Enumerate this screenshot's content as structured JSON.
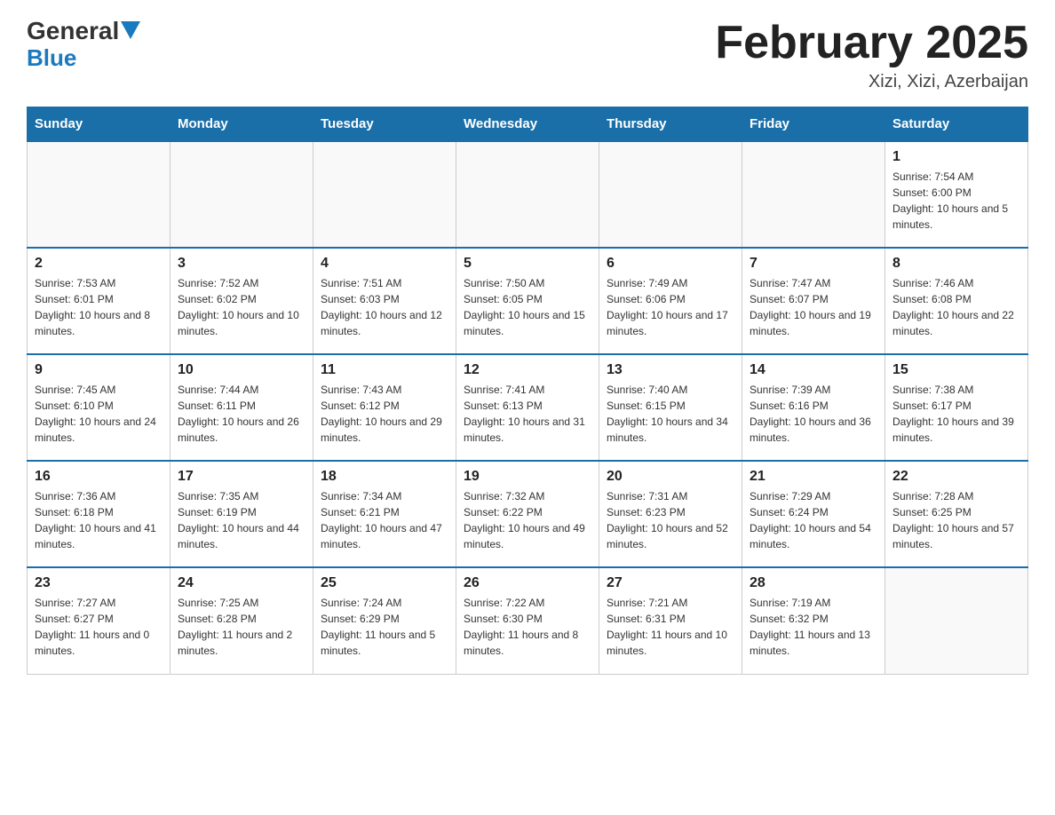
{
  "header": {
    "logo_text_general": "General",
    "logo_text_blue": "Blue",
    "month_title": "February 2025",
    "location": "Xizi, Xizi, Azerbaijan"
  },
  "weekdays": [
    "Sunday",
    "Monday",
    "Tuesday",
    "Wednesday",
    "Thursday",
    "Friday",
    "Saturday"
  ],
  "weeks": [
    [
      {
        "day": "",
        "sunrise": "",
        "sunset": "",
        "daylight": ""
      },
      {
        "day": "",
        "sunrise": "",
        "sunset": "",
        "daylight": ""
      },
      {
        "day": "",
        "sunrise": "",
        "sunset": "",
        "daylight": ""
      },
      {
        "day": "",
        "sunrise": "",
        "sunset": "",
        "daylight": ""
      },
      {
        "day": "",
        "sunrise": "",
        "sunset": "",
        "daylight": ""
      },
      {
        "day": "",
        "sunrise": "",
        "sunset": "",
        "daylight": ""
      },
      {
        "day": "1",
        "sunrise": "Sunrise: 7:54 AM",
        "sunset": "Sunset: 6:00 PM",
        "daylight": "Daylight: 10 hours and 5 minutes."
      }
    ],
    [
      {
        "day": "2",
        "sunrise": "Sunrise: 7:53 AM",
        "sunset": "Sunset: 6:01 PM",
        "daylight": "Daylight: 10 hours and 8 minutes."
      },
      {
        "day": "3",
        "sunrise": "Sunrise: 7:52 AM",
        "sunset": "Sunset: 6:02 PM",
        "daylight": "Daylight: 10 hours and 10 minutes."
      },
      {
        "day": "4",
        "sunrise": "Sunrise: 7:51 AM",
        "sunset": "Sunset: 6:03 PM",
        "daylight": "Daylight: 10 hours and 12 minutes."
      },
      {
        "day": "5",
        "sunrise": "Sunrise: 7:50 AM",
        "sunset": "Sunset: 6:05 PM",
        "daylight": "Daylight: 10 hours and 15 minutes."
      },
      {
        "day": "6",
        "sunrise": "Sunrise: 7:49 AM",
        "sunset": "Sunset: 6:06 PM",
        "daylight": "Daylight: 10 hours and 17 minutes."
      },
      {
        "day": "7",
        "sunrise": "Sunrise: 7:47 AM",
        "sunset": "Sunset: 6:07 PM",
        "daylight": "Daylight: 10 hours and 19 minutes."
      },
      {
        "day": "8",
        "sunrise": "Sunrise: 7:46 AM",
        "sunset": "Sunset: 6:08 PM",
        "daylight": "Daylight: 10 hours and 22 minutes."
      }
    ],
    [
      {
        "day": "9",
        "sunrise": "Sunrise: 7:45 AM",
        "sunset": "Sunset: 6:10 PM",
        "daylight": "Daylight: 10 hours and 24 minutes."
      },
      {
        "day": "10",
        "sunrise": "Sunrise: 7:44 AM",
        "sunset": "Sunset: 6:11 PM",
        "daylight": "Daylight: 10 hours and 26 minutes."
      },
      {
        "day": "11",
        "sunrise": "Sunrise: 7:43 AM",
        "sunset": "Sunset: 6:12 PM",
        "daylight": "Daylight: 10 hours and 29 minutes."
      },
      {
        "day": "12",
        "sunrise": "Sunrise: 7:41 AM",
        "sunset": "Sunset: 6:13 PM",
        "daylight": "Daylight: 10 hours and 31 minutes."
      },
      {
        "day": "13",
        "sunrise": "Sunrise: 7:40 AM",
        "sunset": "Sunset: 6:15 PM",
        "daylight": "Daylight: 10 hours and 34 minutes."
      },
      {
        "day": "14",
        "sunrise": "Sunrise: 7:39 AM",
        "sunset": "Sunset: 6:16 PM",
        "daylight": "Daylight: 10 hours and 36 minutes."
      },
      {
        "day": "15",
        "sunrise": "Sunrise: 7:38 AM",
        "sunset": "Sunset: 6:17 PM",
        "daylight": "Daylight: 10 hours and 39 minutes."
      }
    ],
    [
      {
        "day": "16",
        "sunrise": "Sunrise: 7:36 AM",
        "sunset": "Sunset: 6:18 PM",
        "daylight": "Daylight: 10 hours and 41 minutes."
      },
      {
        "day": "17",
        "sunrise": "Sunrise: 7:35 AM",
        "sunset": "Sunset: 6:19 PM",
        "daylight": "Daylight: 10 hours and 44 minutes."
      },
      {
        "day": "18",
        "sunrise": "Sunrise: 7:34 AM",
        "sunset": "Sunset: 6:21 PM",
        "daylight": "Daylight: 10 hours and 47 minutes."
      },
      {
        "day": "19",
        "sunrise": "Sunrise: 7:32 AM",
        "sunset": "Sunset: 6:22 PM",
        "daylight": "Daylight: 10 hours and 49 minutes."
      },
      {
        "day": "20",
        "sunrise": "Sunrise: 7:31 AM",
        "sunset": "Sunset: 6:23 PM",
        "daylight": "Daylight: 10 hours and 52 minutes."
      },
      {
        "day": "21",
        "sunrise": "Sunrise: 7:29 AM",
        "sunset": "Sunset: 6:24 PM",
        "daylight": "Daylight: 10 hours and 54 minutes."
      },
      {
        "day": "22",
        "sunrise": "Sunrise: 7:28 AM",
        "sunset": "Sunset: 6:25 PM",
        "daylight": "Daylight: 10 hours and 57 minutes."
      }
    ],
    [
      {
        "day": "23",
        "sunrise": "Sunrise: 7:27 AM",
        "sunset": "Sunset: 6:27 PM",
        "daylight": "Daylight: 11 hours and 0 minutes."
      },
      {
        "day": "24",
        "sunrise": "Sunrise: 7:25 AM",
        "sunset": "Sunset: 6:28 PM",
        "daylight": "Daylight: 11 hours and 2 minutes."
      },
      {
        "day": "25",
        "sunrise": "Sunrise: 7:24 AM",
        "sunset": "Sunset: 6:29 PM",
        "daylight": "Daylight: 11 hours and 5 minutes."
      },
      {
        "day": "26",
        "sunrise": "Sunrise: 7:22 AM",
        "sunset": "Sunset: 6:30 PM",
        "daylight": "Daylight: 11 hours and 8 minutes."
      },
      {
        "day": "27",
        "sunrise": "Sunrise: 7:21 AM",
        "sunset": "Sunset: 6:31 PM",
        "daylight": "Daylight: 11 hours and 10 minutes."
      },
      {
        "day": "28",
        "sunrise": "Sunrise: 7:19 AM",
        "sunset": "Sunset: 6:32 PM",
        "daylight": "Daylight: 11 hours and 13 minutes."
      },
      {
        "day": "",
        "sunrise": "",
        "sunset": "",
        "daylight": ""
      }
    ]
  ]
}
